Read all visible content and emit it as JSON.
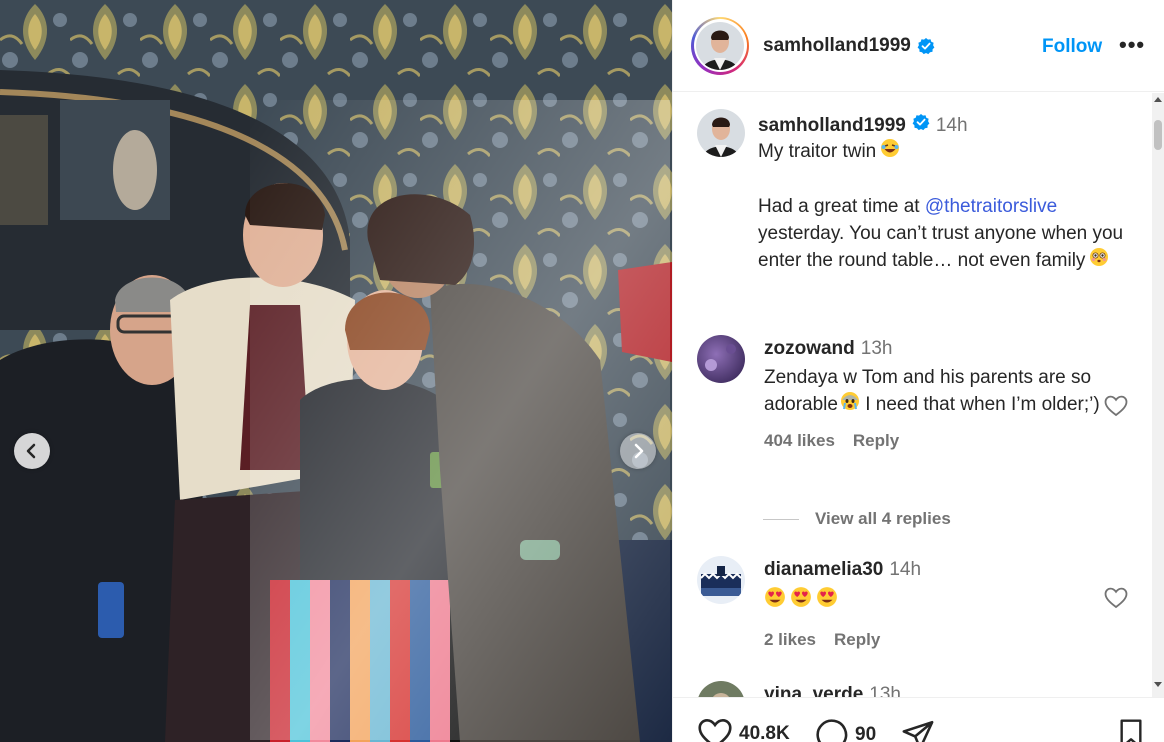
{
  "post": {
    "username": "samholland1999",
    "follow_label": "Follow",
    "more_label": "•••"
  },
  "caption": {
    "username": "samholland1999",
    "time": "14h",
    "line1": "My traitor twin",
    "body_prefix": "Had a great time at ",
    "mention": "@thetraitorslive",
    "body_suffix": " yesterday. You can’t trust anyone when you enter the round table… not even family"
  },
  "comments": [
    {
      "username": "zozowand",
      "time": "13h",
      "text_a": "Zendaya w Tom and his parents are so adorable",
      "text_b": " I need that when I’m older;’)",
      "likes": "404 likes",
      "reply": "Reply",
      "view_replies": "View all 4 replies"
    },
    {
      "username": "dianamelia30",
      "time": "14h",
      "likes": "2 likes",
      "reply": "Reply"
    },
    {
      "username": "yina_verde",
      "time": "13h"
    }
  ],
  "actions": {
    "likes_count": "40.8K",
    "comments_count": "90"
  },
  "colors": {
    "link": "#0095f6",
    "mention": "#3b5bdb",
    "muted": "#737373"
  }
}
